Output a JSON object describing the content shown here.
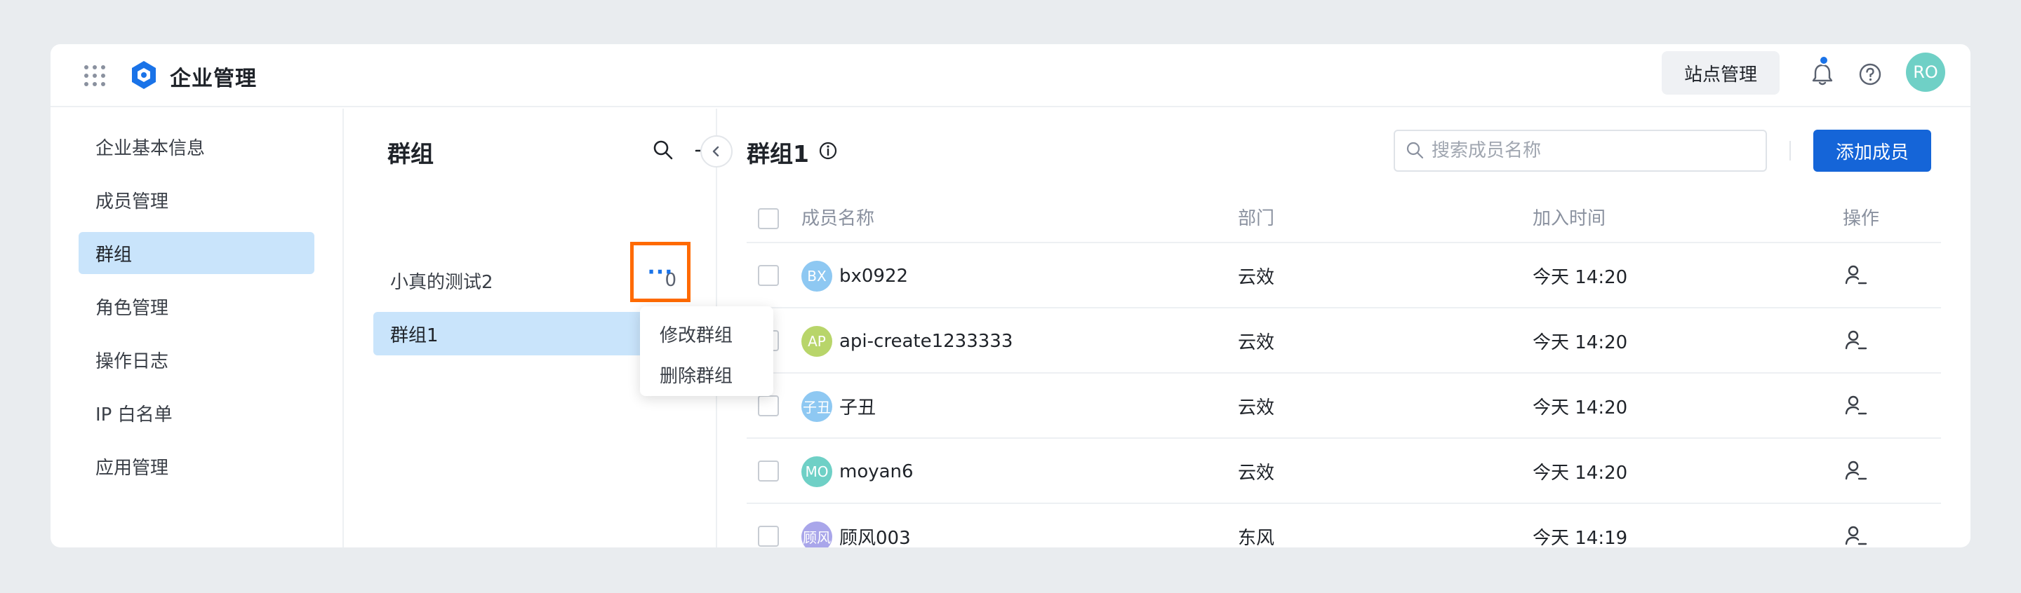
{
  "header": {
    "app_title": "企业管理",
    "site_button": "站点管理",
    "user_avatar": "RO",
    "icons": [
      "apps-grid-icon",
      "logo-icon",
      "bell-icon",
      "help-icon"
    ],
    "notification_dot_color": "#1a73e8"
  },
  "nav": {
    "items": [
      {
        "label": "企业基本信息"
      },
      {
        "label": "成员管理"
      },
      {
        "label": "群组",
        "active": true
      },
      {
        "label": "角色管理"
      },
      {
        "label": "操作日志"
      },
      {
        "label": "IP 白名单"
      },
      {
        "label": "应用管理"
      }
    ]
  },
  "groups": {
    "title": "群组",
    "list": [
      {
        "name": "小真的测试2",
        "count": "0"
      },
      {
        "name": "群组1",
        "active": true
      }
    ],
    "more_label": "···",
    "menu": [
      "修改群组",
      "删除群组"
    ]
  },
  "main": {
    "title": "群组1",
    "search_placeholder": "搜索成员名称",
    "add_button": "添加成员",
    "columns": [
      "成员名称",
      "部门",
      "加入时间",
      "操作"
    ],
    "rows": [
      {
        "avatar": "BX",
        "avatar_color": "#8ec8f2",
        "name": "bx0922",
        "dept": "云效",
        "time": "今天 14:20"
      },
      {
        "avatar": "AP",
        "avatar_color": "#b8d56a",
        "name": "api-create1233333",
        "dept": "云效",
        "time": "今天 14:20"
      },
      {
        "avatar": "子丑",
        "avatar_color": "#8ec8f2",
        "name": "子丑",
        "dept": "云效",
        "time": "今天 14:20"
      },
      {
        "avatar": "MO",
        "avatar_color": "#6fd0c6",
        "name": "moyan6",
        "dept": "云效",
        "time": "今天 14:20"
      },
      {
        "avatar": "顾风",
        "avatar_color": "#a9a6ea",
        "name": "顾风003",
        "dept": "东风",
        "time": "今天 14:19"
      }
    ]
  },
  "colors": {
    "accent": "#1565d8",
    "active_bg": "#c9e4fb",
    "highlight_border": "#ff6a00"
  }
}
